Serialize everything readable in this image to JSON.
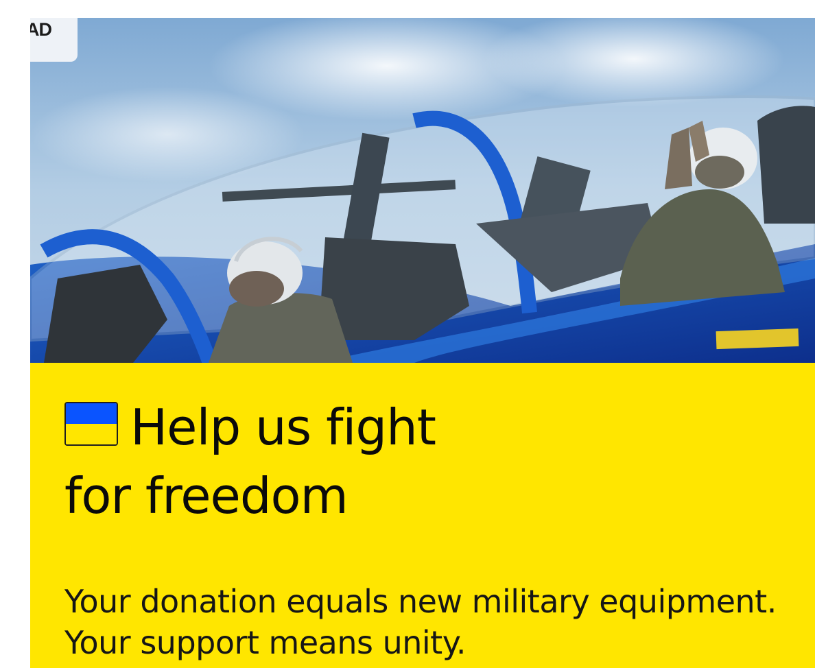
{
  "ad": {
    "badge_label": "AD",
    "photo_subject": "fighter-jet-cockpit",
    "headline_line1": "Help us fight",
    "headline_line2": "for freedom",
    "body": "Your donation equals new military equipment. Your support means unity.",
    "flag_colors": {
      "top": "#0a54ff",
      "bottom": "#ffe600"
    },
    "panel_color": "#ffe600"
  }
}
